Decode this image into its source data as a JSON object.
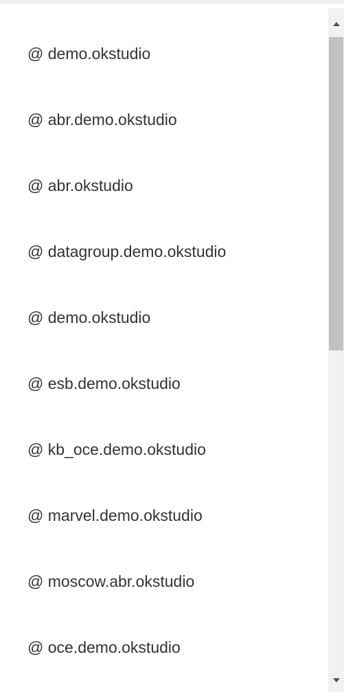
{
  "items": [
    {
      "label": "@ demo.okstudio"
    },
    {
      "label": "@ abr.demo.okstudio"
    },
    {
      "label": "@ abr.okstudio"
    },
    {
      "label": "@ datagroup.demo.okstudio"
    },
    {
      "label": "@ demo.okstudio"
    },
    {
      "label": "@ esb.demo.okstudio"
    },
    {
      "label": "@ kb_oce.demo.okstudio"
    },
    {
      "label": "@ marvel.demo.okstudio"
    },
    {
      "label": "@ moscow.abr.okstudio"
    },
    {
      "label": "@ oce.demo.okstudio"
    }
  ],
  "icons": {
    "scroll_up": "triangle-up-icon",
    "scroll_down": "triangle-down-icon"
  },
  "colors": {
    "text": "#333333",
    "scrollbar_track": "#f1f1f1",
    "scrollbar_thumb": "#c1c1c1",
    "scroll_arrow": "#505050"
  }
}
